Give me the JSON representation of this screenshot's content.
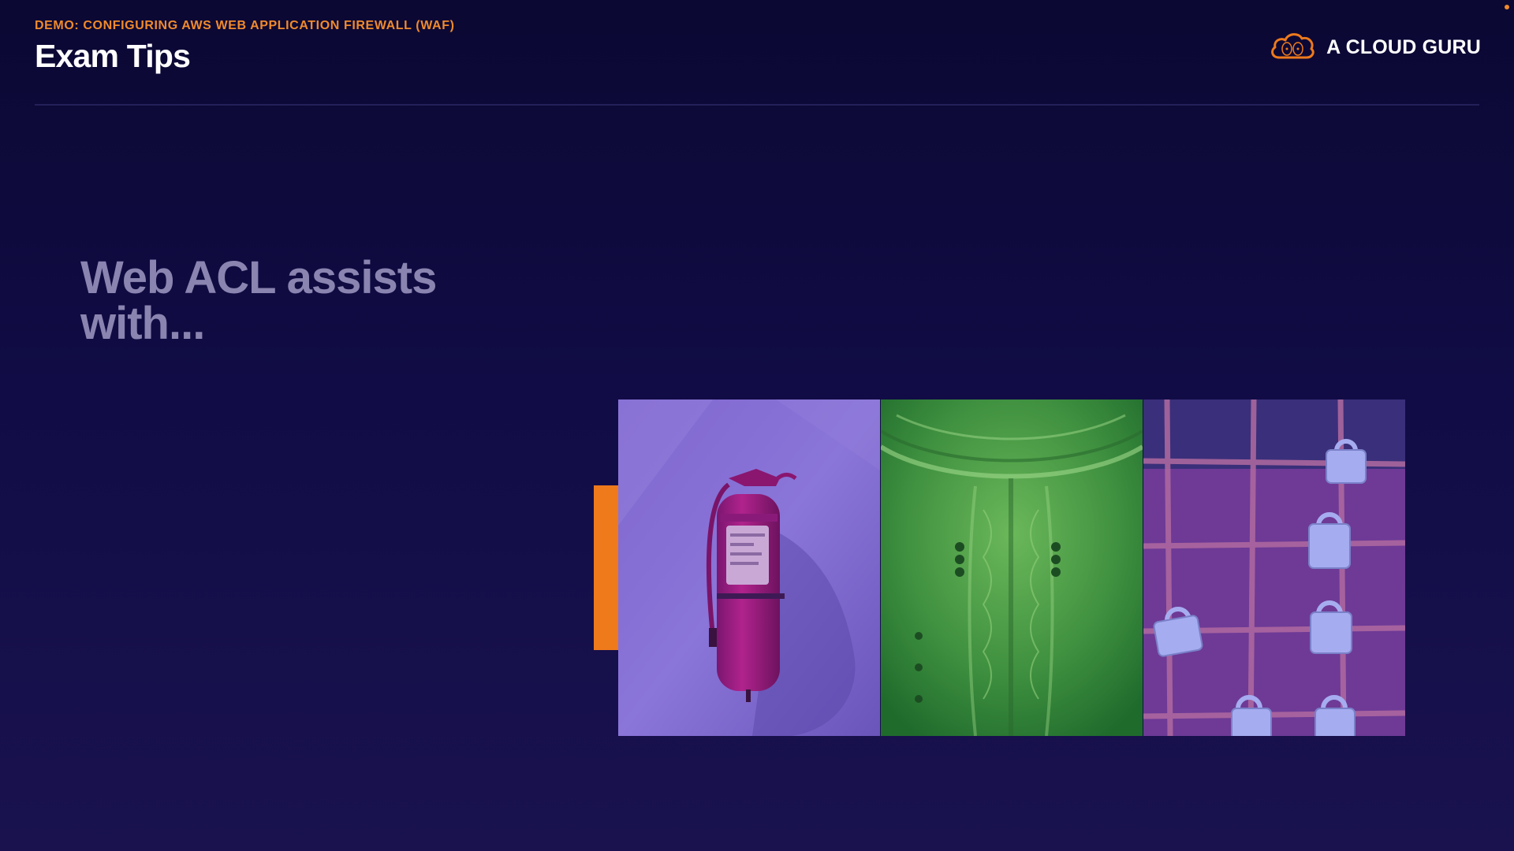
{
  "header": {
    "kicker": "DEMO: CONFIGURING AWS WEB APPLICATION FIREWALL (WAF)",
    "title": "Exam Tips"
  },
  "brand": {
    "name": "A CLOUD GURU",
    "icon": "cloud-logo-icon"
  },
  "slide": {
    "headline": "Web ACL assists with..."
  },
  "images": [
    {
      "subject": "fire-extinguisher",
      "tint": "#7a63c9"
    },
    {
      "subject": "armor",
      "tint": "#2f8a3a"
    },
    {
      "subject": "padlocks",
      "tint": "#6e3a96"
    }
  ],
  "colors": {
    "accent": "#ee7a1c",
    "background": "#110c45",
    "headline": "#8a84b0"
  }
}
